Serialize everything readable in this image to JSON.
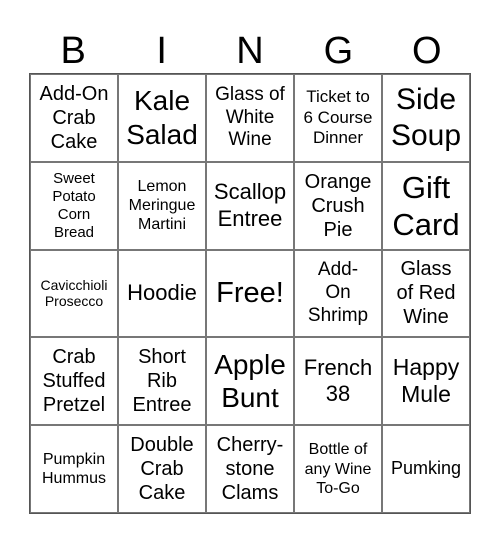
{
  "header": {
    "letters": [
      "B",
      "I",
      "N",
      "G",
      "O"
    ]
  },
  "cells": [
    "Add-On\nCrab\nCake",
    "Kale\nSalad",
    "Glass of\nWhite\nWine",
    "Ticket to\n6 Course\nDinner",
    "Side\nSoup",
    "Sweet\nPotato\nCorn\nBread",
    "Lemon\nMeringue\nMartini",
    "Scallop\nEntree",
    "Orange\nCrush\nPie",
    "Gift\nCard",
    "Cavicchioli\nProsecco",
    "Hoodie",
    "Free!",
    "Add-\nOn\nShrimp",
    "Glass\nof Red\nWine",
    "Crab\nStuffed\nPretzel",
    "Short\nRib\nEntree",
    "Apple\nBunt",
    "French\n38",
    "Happy\nMule",
    "Pumpkin\nHummus",
    "Double\nCrab\nCake",
    "Cherry-\nstone\nClams",
    "Bottle of\nany Wine\nTo-Go",
    "Pumking"
  ]
}
